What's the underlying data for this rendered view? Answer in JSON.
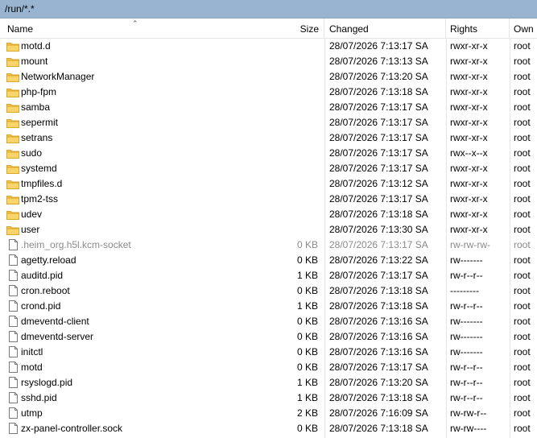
{
  "path": "/run/*.*",
  "columns": {
    "name": "Name",
    "size": "Size",
    "changed": "Changed",
    "rights": "Rights",
    "owner": "Own"
  },
  "colors": {
    "pathbar": "#99b4d1",
    "folder": "#f4c34e",
    "grid": "#e5e5e5",
    "dimmed_text": "#8a8a8a"
  },
  "rows": [
    {
      "type": "folder",
      "name": "motd.d",
      "size": "",
      "changed": "28/07/2026 7:13:17 SA",
      "rights": "rwxr-xr-x",
      "owner": "root"
    },
    {
      "type": "folder",
      "name": "mount",
      "size": "",
      "changed": "28/07/2026 7:13:13 SA",
      "rights": "rwxr-xr-x",
      "owner": "root"
    },
    {
      "type": "folder",
      "name": "NetworkManager",
      "size": "",
      "changed": "28/07/2026 7:13:20 SA",
      "rights": "rwxr-xr-x",
      "owner": "root"
    },
    {
      "type": "folder",
      "name": "php-fpm",
      "size": "",
      "changed": "28/07/2026 7:13:18 SA",
      "rights": "rwxr-xr-x",
      "owner": "root"
    },
    {
      "type": "folder",
      "name": "samba",
      "size": "",
      "changed": "28/07/2026 7:13:17 SA",
      "rights": "rwxr-xr-x",
      "owner": "root"
    },
    {
      "type": "folder",
      "name": "sepermit",
      "size": "",
      "changed": "28/07/2026 7:13:17 SA",
      "rights": "rwxr-xr-x",
      "owner": "root"
    },
    {
      "type": "folder",
      "name": "setrans",
      "size": "",
      "changed": "28/07/2026 7:13:17 SA",
      "rights": "rwxr-xr-x",
      "owner": "root"
    },
    {
      "type": "folder",
      "name": "sudo",
      "size": "",
      "changed": "28/07/2026 7:13:17 SA",
      "rights": "rwx--x--x",
      "owner": "root"
    },
    {
      "type": "folder",
      "name": "systemd",
      "size": "",
      "changed": "28/07/2026 7:13:17 SA",
      "rights": "rwxr-xr-x",
      "owner": "root"
    },
    {
      "type": "folder",
      "name": "tmpfiles.d",
      "size": "",
      "changed": "28/07/2026 7:13:12 SA",
      "rights": "rwxr-xr-x",
      "owner": "root"
    },
    {
      "type": "folder",
      "name": "tpm2-tss",
      "size": "",
      "changed": "28/07/2026 7:13:17 SA",
      "rights": "rwxr-xr-x",
      "owner": "root"
    },
    {
      "type": "folder",
      "name": "udev",
      "size": "",
      "changed": "28/07/2026 7:13:18 SA",
      "rights": "rwxr-xr-x",
      "owner": "root"
    },
    {
      "type": "folder",
      "name": "user",
      "size": "",
      "changed": "28/07/2026 7:13:30 SA",
      "rights": "rwxr-xr-x",
      "owner": "root"
    },
    {
      "type": "file",
      "dim": true,
      "name": ".heim_org.h5l.kcm-socket",
      "size": "0 KB",
      "changed": "28/07/2026 7:13:17 SA",
      "rights": "rw-rw-rw-",
      "owner": "root"
    },
    {
      "type": "file",
      "name": "agetty.reload",
      "size": "0 KB",
      "changed": "28/07/2026 7:13:22 SA",
      "rights": "rw-------",
      "owner": "root"
    },
    {
      "type": "file",
      "name": "auditd.pid",
      "size": "1 KB",
      "changed": "28/07/2026 7:13:17 SA",
      "rights": "rw-r--r--",
      "owner": "root"
    },
    {
      "type": "file",
      "name": "cron.reboot",
      "size": "0 KB",
      "changed": "28/07/2026 7:13:18 SA",
      "rights": "---------",
      "owner": "root"
    },
    {
      "type": "file",
      "name": "crond.pid",
      "size": "1 KB",
      "changed": "28/07/2026 7:13:18 SA",
      "rights": "rw-r--r--",
      "owner": "root"
    },
    {
      "type": "file",
      "name": "dmeventd-client",
      "size": "0 KB",
      "changed": "28/07/2026 7:13:16 SA",
      "rights": "rw-------",
      "owner": "root"
    },
    {
      "type": "file",
      "name": "dmeventd-server",
      "size": "0 KB",
      "changed": "28/07/2026 7:13:16 SA",
      "rights": "rw-------",
      "owner": "root"
    },
    {
      "type": "file",
      "name": "initctl",
      "size": "0 KB",
      "changed": "28/07/2026 7:13:16 SA",
      "rights": "rw-------",
      "owner": "root"
    },
    {
      "type": "file",
      "name": "motd",
      "size": "0 KB",
      "changed": "28/07/2026 7:13:17 SA",
      "rights": "rw-r--r--",
      "owner": "root"
    },
    {
      "type": "file",
      "name": "rsyslogd.pid",
      "size": "1 KB",
      "changed": "28/07/2026 7:13:20 SA",
      "rights": "rw-r--r--",
      "owner": "root"
    },
    {
      "type": "file",
      "name": "sshd.pid",
      "size": "1 KB",
      "changed": "28/07/2026 7:13:18 SA",
      "rights": "rw-r--r--",
      "owner": "root"
    },
    {
      "type": "file",
      "name": "utmp",
      "size": "2 KB",
      "changed": "28/07/2026 7:16:09 SA",
      "rights": "rw-rw-r--",
      "owner": "root"
    },
    {
      "type": "file",
      "name": "zx-panel-controller.sock",
      "size": "0 KB",
      "changed": "28/07/2026 7:13:18 SA",
      "rights": "rw-rw----",
      "owner": "root"
    }
  ]
}
